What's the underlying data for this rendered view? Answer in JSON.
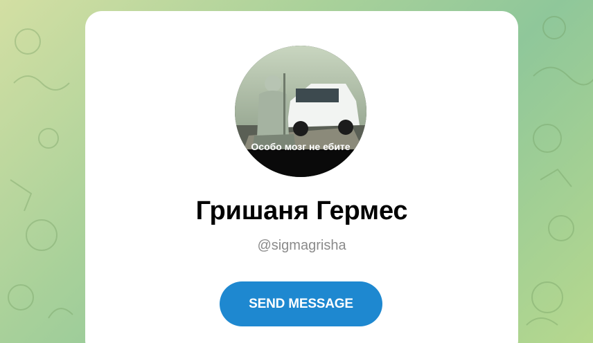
{
  "profile": {
    "avatar_caption": "Особо мозг не ебите",
    "name": "Гришаня Гермес",
    "username": "@sigmagrisha"
  },
  "actions": {
    "send_label": "SEND MESSAGE"
  },
  "colors": {
    "accent": "#1e88d0",
    "card": "#ffffff",
    "username_text": "#8a8a8a",
    "background_start": "#d3dfa3",
    "background_end": "#8fc79a"
  }
}
